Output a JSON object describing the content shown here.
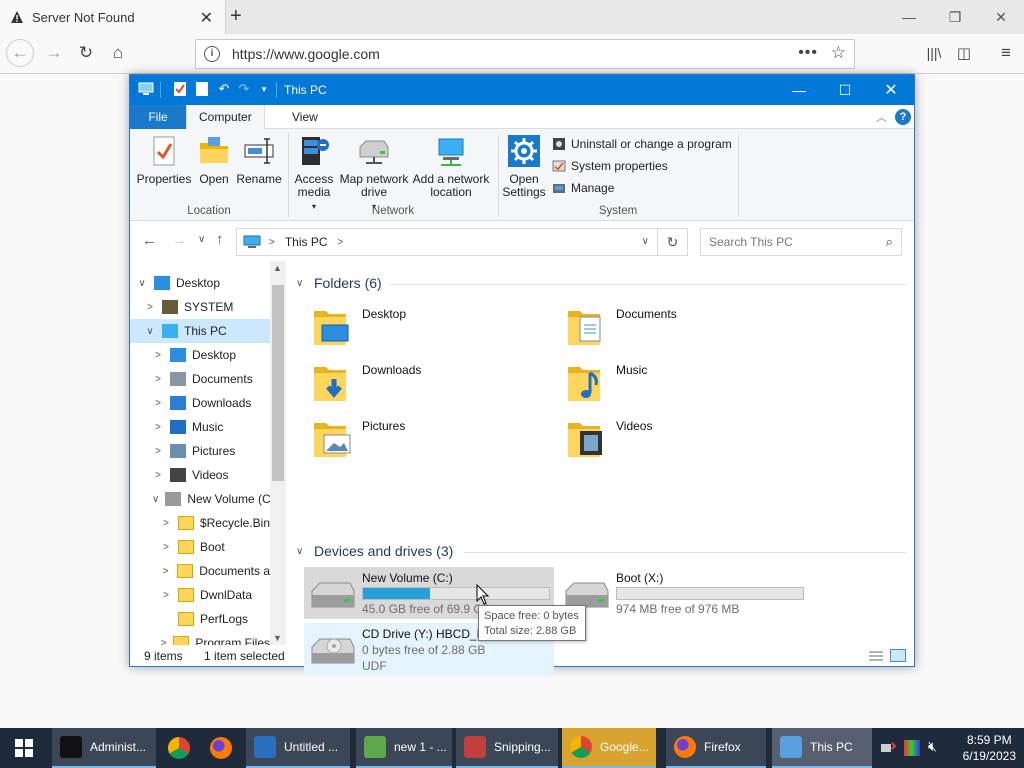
{
  "browser": {
    "tab_title": "Server Not Found",
    "url": "https://www.google.com"
  },
  "explorer": {
    "title": "This PC",
    "ribbon_tabs": [
      "File",
      "Computer",
      "View"
    ],
    "ribbon": {
      "location": {
        "label": "Location",
        "buttons": [
          "Properties",
          "Open",
          "Rename"
        ]
      },
      "network": {
        "label": "Network",
        "access_media": "Access media",
        "map_network_drive": "Map network drive",
        "add_network_location": "Add a network location"
      },
      "system": {
        "label": "System",
        "open_settings": "Open Settings",
        "uninstall": "Uninstall or change a program",
        "system_properties": "System properties",
        "manage": "Manage"
      }
    },
    "address": {
      "crumb": "This PC",
      "search_placeholder": "Search This PC"
    },
    "nav_tree": [
      {
        "label": "Desktop",
        "chev": "∨",
        "indent": 0,
        "icon": "desktop-icon",
        "selected": false
      },
      {
        "label": "SYSTEM",
        "chev": ">",
        "indent": 1,
        "icon": "user-icon",
        "selected": false
      },
      {
        "label": "This PC",
        "chev": "∨",
        "indent": 1,
        "icon": "pc-icon",
        "selected": true
      },
      {
        "label": "Desktop",
        "chev": ">",
        "indent": 2,
        "icon": "desktop-icon",
        "selected": false
      },
      {
        "label": "Documents",
        "chev": ">",
        "indent": 2,
        "icon": "documents-icon",
        "selected": false
      },
      {
        "label": "Downloads",
        "chev": ">",
        "indent": 2,
        "icon": "downloads-icon",
        "selected": false
      },
      {
        "label": "Music",
        "chev": ">",
        "indent": 2,
        "icon": "music-icon",
        "selected": false
      },
      {
        "label": "Pictures",
        "chev": ">",
        "indent": 2,
        "icon": "pictures-icon",
        "selected": false
      },
      {
        "label": "Videos",
        "chev": ">",
        "indent": 2,
        "icon": "videos-icon",
        "selected": false
      },
      {
        "label": "New Volume (C",
        "chev": "∨",
        "indent": 2,
        "icon": "drive-icon",
        "selected": false
      },
      {
        "label": "$Recycle.Bin",
        "chev": ">",
        "indent": 3,
        "icon": "folder-icon",
        "selected": false
      },
      {
        "label": "Boot",
        "chev": ">",
        "indent": 3,
        "icon": "folder-icon",
        "selected": false
      },
      {
        "label": "Documents a",
        "chev": ">",
        "indent": 3,
        "icon": "folder-icon",
        "selected": false
      },
      {
        "label": "DwnlData",
        "chev": ">",
        "indent": 3,
        "icon": "folder-icon",
        "selected": false
      },
      {
        "label": "PerfLogs",
        "chev": "",
        "indent": 3,
        "icon": "folder-icon",
        "selected": false
      },
      {
        "label": "Program Files",
        "chev": ">",
        "indent": 3,
        "icon": "folder-icon",
        "selected": false
      }
    ],
    "folders_header": "Folders (6)",
    "folders": [
      {
        "label": "Desktop",
        "icon": "desktop-folder-icon"
      },
      {
        "label": "Documents",
        "icon": "documents-folder-icon"
      },
      {
        "label": "Downloads",
        "icon": "downloads-folder-icon"
      },
      {
        "label": "Music",
        "icon": "music-folder-icon"
      },
      {
        "label": "Pictures",
        "icon": "pictures-folder-icon"
      },
      {
        "label": "Videos",
        "icon": "videos-folder-icon"
      }
    ],
    "drives_header": "Devices and drives (3)",
    "drives": [
      {
        "name": "New Volume (C:)",
        "free": "45.0 GB free of 69.9 GB",
        "used_fraction": 0.36
      },
      {
        "name": "Boot (X:)",
        "free": "974 MB free of 976 MB",
        "used_fraction": 0.0
      },
      {
        "name": "CD Drive (Y:) HBCD_PE_x64",
        "line2": "0 bytes free of 2.88 GB",
        "line3": "UDF"
      }
    ],
    "tooltip": {
      "line1": "Space free: 0 bytes",
      "line2": "Total size: 2.88 GB"
    },
    "status": {
      "items": "9 items",
      "selected": "1 item selected"
    }
  },
  "taskbar": {
    "items": [
      {
        "label": "Administ...",
        "style": "win"
      },
      {
        "label": "",
        "style": "pin-chrome"
      },
      {
        "label": "",
        "style": "pin-firefox"
      },
      {
        "label": "Untitled ...",
        "style": "win"
      },
      {
        "label": "new 1 - ...",
        "style": "win"
      },
      {
        "label": "Snipping...",
        "style": "win"
      },
      {
        "label": "Google...",
        "style": "act"
      },
      {
        "label": "Firefox",
        "style": "win"
      },
      {
        "label": "This PC",
        "style": "cur"
      }
    ],
    "time": "8:59 PM",
    "date": "6/19/2023"
  },
  "colors": {
    "accent": "#0078d7",
    "selection": "#cce8ff",
    "drive_bar": "#26a0da"
  }
}
